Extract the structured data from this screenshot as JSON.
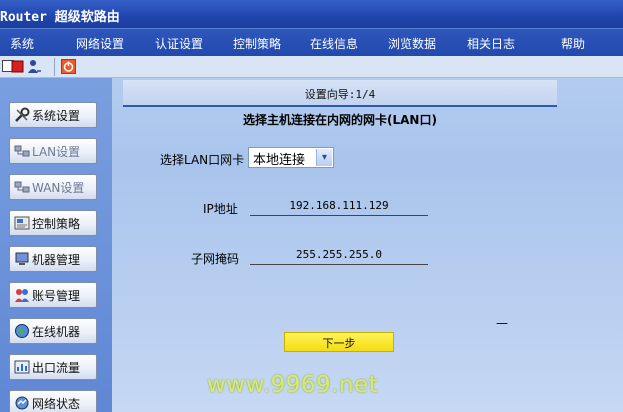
{
  "title_bar": {
    "text": "Router 超级软路由"
  },
  "menu": {
    "items": [
      "系统",
      "网络设置",
      "认证设置",
      "控制策略",
      "在线信息",
      "浏览数据",
      "相关日志",
      "帮助"
    ]
  },
  "toolbar": {
    "icons": [
      "checkbox-icon",
      "stop-icon",
      "user-icon",
      "power-icon"
    ]
  },
  "sidebar": {
    "items": [
      {
        "label": "系统设置",
        "icon": "wrench-icon"
      },
      {
        "label": "LAN设置",
        "icon": "network-icon"
      },
      {
        "label": "WAN设置",
        "icon": "network-icon"
      },
      {
        "label": "控制策略",
        "icon": "policy-icon"
      },
      {
        "label": "机器管理",
        "icon": "computer-icon"
      },
      {
        "label": "账号管理",
        "icon": "users-icon"
      },
      {
        "label": "在线机器",
        "icon": "globe-icon"
      },
      {
        "label": "出口流量",
        "icon": "traffic-icon"
      },
      {
        "label": "网络状态",
        "icon": "status-icon"
      }
    ]
  },
  "wizard": {
    "header": "设置向导:1/4",
    "title": "选择主机连接在内网的网卡(LAN口)",
    "lan_label": "选择LAN口网卡",
    "lan_select_value": "本地连接",
    "ip_label": "IP地址",
    "ip_value": "192.168.111.129",
    "mask_label": "子网掩码",
    "mask_value": "255.255.255.0",
    "next_button": "下一步",
    "dash": "—"
  },
  "watermark": "www.9969.net",
  "colors": {
    "titlebar": "#1f45ad",
    "sidebar": "#6a8fd9",
    "next_button": "#f5e11e",
    "accent_line": "#2b57b8"
  }
}
